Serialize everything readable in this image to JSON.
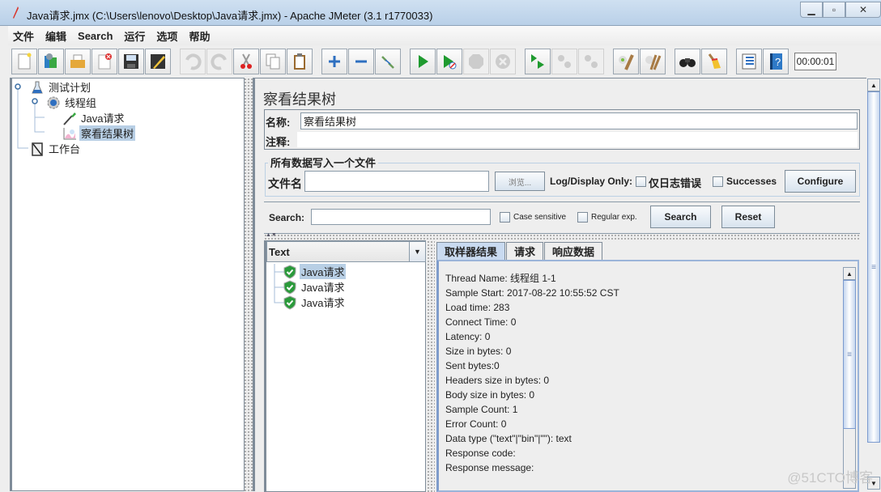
{
  "window": {
    "title": "Java请求.jmx (C:\\Users\\lenovo\\Desktop\\Java请求.jmx) - Apache JMeter (3.1 r1770033)",
    "controls": {
      "minimize": "▁",
      "maximize": "▫",
      "close": "✕"
    }
  },
  "menu": {
    "items": [
      "文件",
      "编辑",
      "Search",
      "运行",
      "选项",
      "帮助"
    ]
  },
  "toolbar": {
    "buttons": [
      {
        "name": "new-icon",
        "enabled": true
      },
      {
        "name": "templates-icon",
        "enabled": true
      },
      {
        "name": "open-icon",
        "enabled": true
      },
      {
        "name": "close-icon",
        "enabled": true
      },
      {
        "name": "save-icon",
        "enabled": true
      },
      {
        "name": "save-as-icon",
        "enabled": true
      },
      {
        "name": "undo-icon",
        "enabled": false
      },
      {
        "name": "redo-icon",
        "enabled": false
      },
      {
        "name": "cut-icon",
        "enabled": true
      },
      {
        "name": "copy-icon",
        "enabled": true
      },
      {
        "name": "paste-icon",
        "enabled": true
      },
      {
        "name": "expand-icon",
        "enabled": true
      },
      {
        "name": "collapse-icon",
        "enabled": true
      },
      {
        "name": "toggle-icon",
        "enabled": true
      },
      {
        "name": "start-icon",
        "enabled": true
      },
      {
        "name": "start-no-pause-icon",
        "enabled": true
      },
      {
        "name": "stop-icon",
        "enabled": false
      },
      {
        "name": "shutdown-icon",
        "enabled": false
      },
      {
        "name": "remote-start-icon",
        "enabled": true
      },
      {
        "name": "remote-stop-icon",
        "enabled": false
      },
      {
        "name": "remote-shutdown-icon",
        "enabled": false
      },
      {
        "name": "clear-icon",
        "enabled": true
      },
      {
        "name": "clear-all-icon",
        "enabled": true
      },
      {
        "name": "search-binoculars-icon",
        "enabled": true
      },
      {
        "name": "reset-search-broom-icon",
        "enabled": true
      },
      {
        "name": "function-helper-icon",
        "enabled": true
      },
      {
        "name": "help-icon",
        "enabled": true
      }
    ],
    "timer": "00:00:01"
  },
  "tree": {
    "items": [
      {
        "label": "测试计划",
        "icon": "test-plan-icon",
        "selected": false
      },
      {
        "label": "线程组",
        "icon": "thread-group-icon",
        "selected": false
      },
      {
        "label": "Java请求",
        "icon": "sampler-icon",
        "selected": false
      },
      {
        "label": "察看结果树",
        "icon": "listener-icon",
        "selected": true
      },
      {
        "label": "工作台",
        "icon": "workbench-icon",
        "selected": false
      }
    ]
  },
  "panel": {
    "title": "察看结果树",
    "name_label": "名称:",
    "name_value": "察看结果树",
    "comment_label": "注释:",
    "comment_value": "",
    "file_section_title": "所有数据写入一个文件",
    "filename_label": "文件名",
    "filename_value": "",
    "browse_label": "浏览...",
    "log_display_label": "Log/Display Only:",
    "errors_only_label": "仅日志错误",
    "successes_label": "Successes",
    "configure_label": "Configure"
  },
  "search": {
    "label": "Search:",
    "value": "",
    "case_sensitive_label": "Case sensitive",
    "regex_label": "Regular exp.",
    "search_button": "Search",
    "reset_button": "Reset"
  },
  "results": {
    "renderer": "Text",
    "samples": [
      {
        "label": "Java请求",
        "status": "success",
        "selected": true
      },
      {
        "label": "Java请求",
        "status": "success",
        "selected": false
      },
      {
        "label": "Java请求",
        "status": "success",
        "selected": false
      }
    ],
    "tabs": [
      "取样器结果",
      "请求",
      "响应数据"
    ],
    "active_tab": 0,
    "details": [
      "Thread Name: 线程组 1-1",
      "Sample Start: 2017-08-22 10:55:52 CST",
      "Load time: 283",
      "Connect Time: 0",
      "Latency: 0",
      "Size in bytes: 0",
      "Sent bytes:0",
      "Headers size in bytes: 0",
      "Body size in bytes: 0",
      "Sample Count: 1",
      "Error Count: 0",
      "Data type (\"text\"|\"bin\"|\"\"): text",
      "Response code:",
      "Response message:"
    ]
  },
  "watermark": "@51CTO博客"
}
